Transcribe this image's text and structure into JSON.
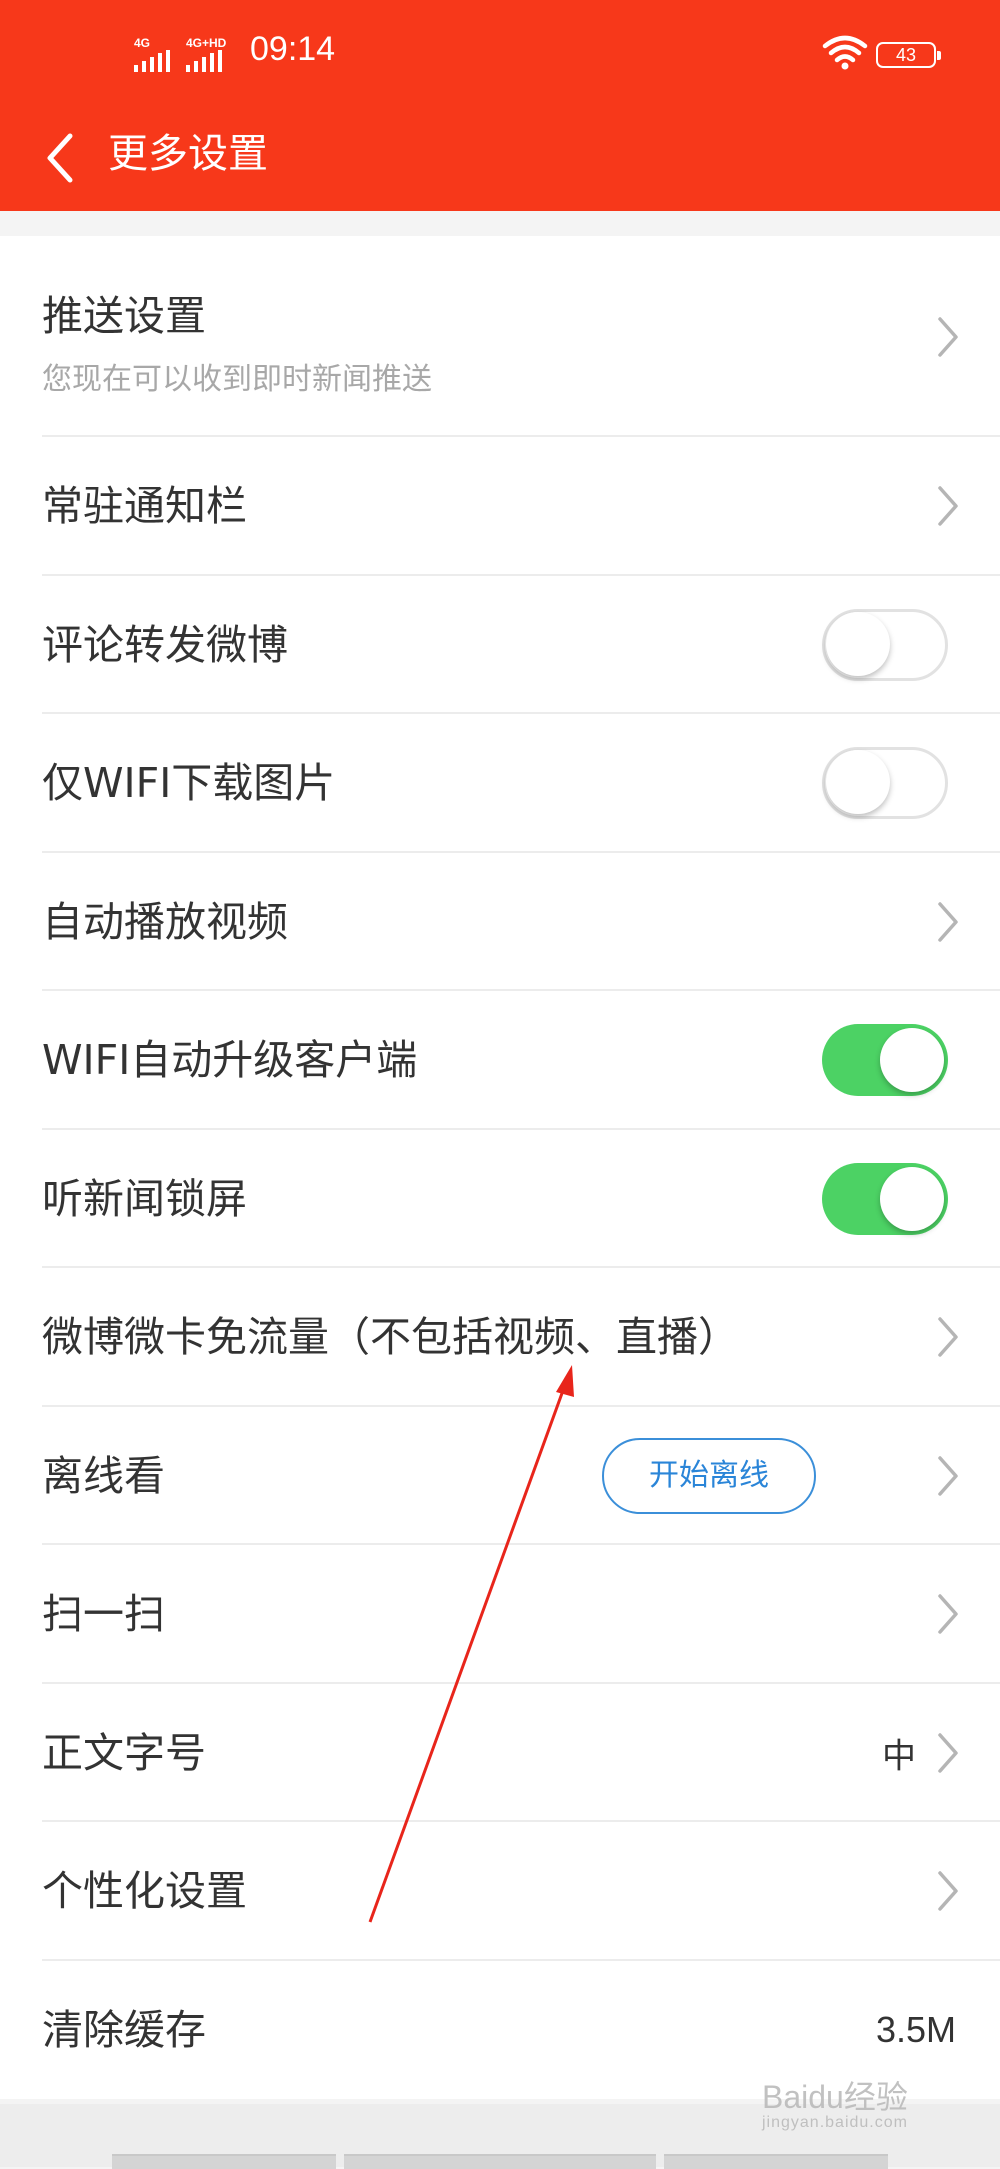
{
  "status_bar": {
    "network1": "4G",
    "network2": "4G+HD",
    "time": "09:14",
    "battery": "43"
  },
  "header": {
    "title": "更多设置",
    "background": "#f7381a"
  },
  "settings": [
    {
      "label": "推送设置",
      "subtitle": "您现在可以收到即时新闻推送",
      "control": "chevron"
    },
    {
      "label": "常驻通知栏",
      "control": "chevron"
    },
    {
      "label": "评论转发微博",
      "control": "toggle",
      "on": false
    },
    {
      "label": "仅WIFI下载图片",
      "control": "toggle",
      "on": false
    },
    {
      "label": "自动播放视频",
      "control": "chevron"
    },
    {
      "label": "WIFI自动升级客户端",
      "control": "toggle",
      "on": true
    },
    {
      "label": "听新闻锁屏",
      "control": "toggle",
      "on": true
    },
    {
      "label": "微博微卡免流量（不包括视频、直播）",
      "control": "chevron"
    },
    {
      "label": "离线看",
      "control": "chevron",
      "button": "开始离线"
    },
    {
      "label": "扫一扫",
      "control": "chevron"
    },
    {
      "label": "正文字号",
      "control": "chevron",
      "value": "中"
    },
    {
      "label": "个性化设置",
      "control": "chevron"
    },
    {
      "label": "清除缓存",
      "control": "value",
      "value": "3.5M"
    }
  ],
  "colors": {
    "toggle_on": "#4cd264",
    "pill_blue": "#2a85d8",
    "annotation_arrow": "#e8251b"
  },
  "watermark": {
    "text": "Baidu经验",
    "sub": "jingyan.baidu.com"
  }
}
